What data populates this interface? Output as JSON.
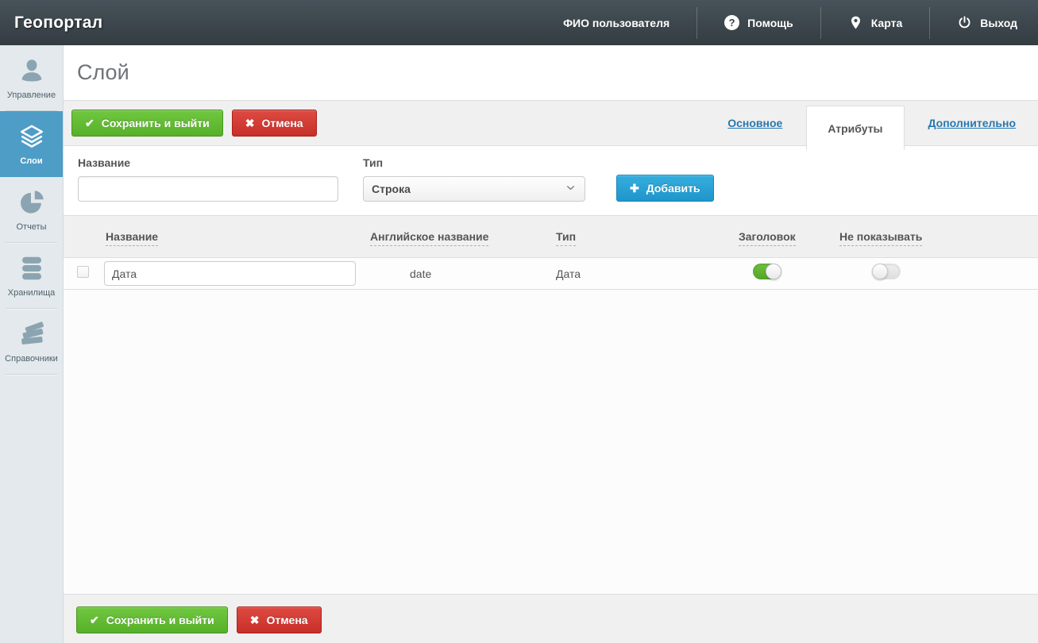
{
  "colors": {
    "header_bg": "#3b444a",
    "sidebar_bg": "#e3e9ec",
    "sidebar_active": "#4d9dc7",
    "accent_green": "#5eb52f",
    "accent_red": "#d03a33",
    "accent_blue": "#2aa4d8",
    "link_blue": "#2878ad"
  },
  "header": {
    "brand": "Геопортал",
    "user_name": "ФИО пользователя",
    "help_label": "Помощь",
    "help_glyph": "?",
    "map_label": "Карта",
    "logout_label": "Выход"
  },
  "sidebar": {
    "items": [
      {
        "label": "Управление",
        "icon": "user-icon",
        "active": false
      },
      {
        "label": "Слои",
        "icon": "layers-icon",
        "active": true
      },
      {
        "label": "Отчеты",
        "icon": "pie-chart-icon",
        "active": false
      },
      {
        "label": "Хранилища",
        "icon": "database-icon",
        "active": false
      },
      {
        "label": "Справочники",
        "icon": "books-icon",
        "active": false
      }
    ]
  },
  "page": {
    "title": "Слой"
  },
  "toolbar": {
    "save_label": "Сохранить и выйти",
    "cancel_label": "Отмена",
    "check_glyph": "✔",
    "cross_glyph": "✖"
  },
  "tabs": [
    {
      "label": "Основное",
      "active": false
    },
    {
      "label": "Атрибуты",
      "active": true
    },
    {
      "label": "Дополнительно",
      "active": false
    }
  ],
  "attribute_form": {
    "name_label": "Название",
    "name_value": "",
    "type_label": "Тип",
    "type_value": "Строка",
    "add_label": "Добавить",
    "plus_glyph": "✚"
  },
  "attributes_table": {
    "columns": [
      "Название",
      "Английское название",
      "Тип",
      "Заголовок",
      "Не показывать"
    ],
    "rows": [
      {
        "name": "Дата",
        "english_name": "date",
        "type": "Дата",
        "header_on": true,
        "hide_on": false,
        "checked": false
      }
    ]
  },
  "footer": {
    "save_label": "Сохранить и выйти",
    "cancel_label": "Отмена",
    "check_glyph": "✔",
    "cross_glyph": "✖"
  }
}
